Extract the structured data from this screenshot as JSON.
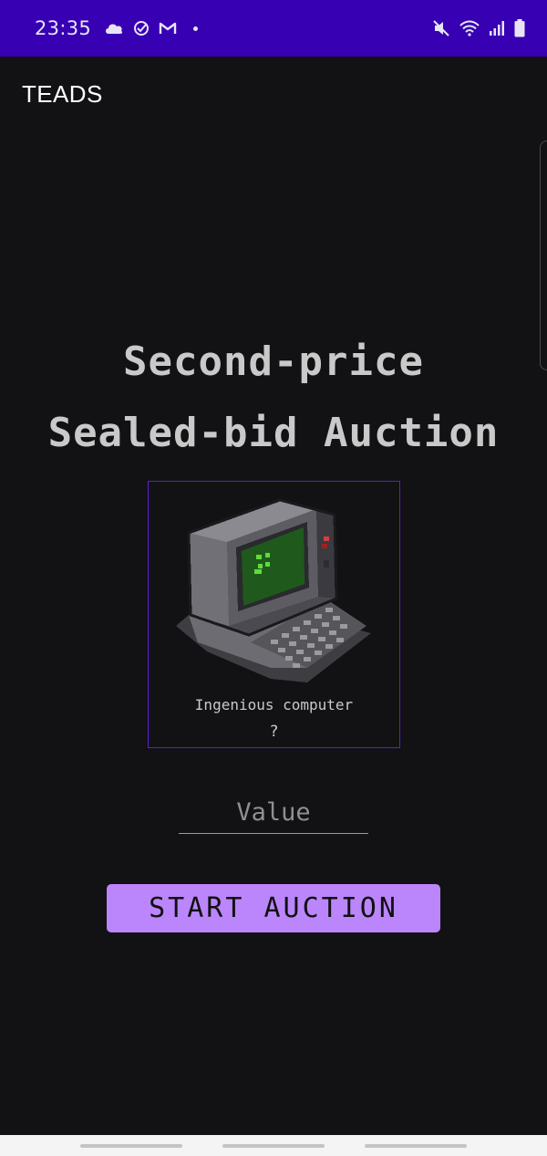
{
  "status_bar": {
    "time": "23:35",
    "left_icons": [
      "cloud-icon",
      "check-circle-icon",
      "gmail-icon",
      "dot-icon"
    ],
    "right_icons": [
      "mute-icon",
      "wifi-icon",
      "signal-icon",
      "battery-icon"
    ],
    "background_color": "#3700b3"
  },
  "app_bar": {
    "title": "TEADS"
  },
  "heading": {
    "line1": "Second-price",
    "line2": "Sealed-bid Auction"
  },
  "item": {
    "image_icon": "pixel-computer-icon",
    "name": "Ingenious computer",
    "price": "?"
  },
  "value_input": {
    "placeholder": "Value",
    "value": ""
  },
  "start_button": {
    "label": "START AUCTION"
  },
  "colors": {
    "background": "#121114",
    "accent": "#bb86fc",
    "card_border": "#5a20d4",
    "heading_text": "#c9c9c9"
  }
}
